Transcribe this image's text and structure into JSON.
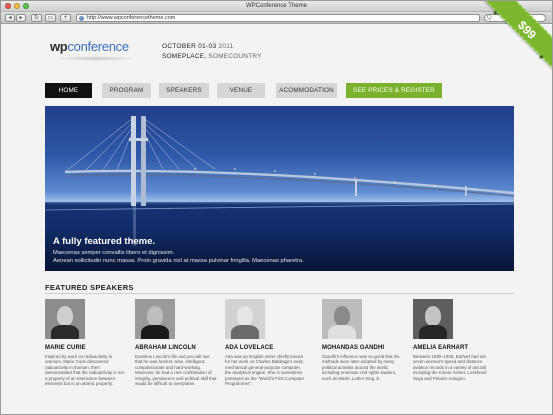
{
  "browser": {
    "window_title": "WPConference Theme",
    "url": "http://www.wpconferencetheme.com",
    "back_glyph": "◂",
    "forward_glyph": "▸",
    "reload_glyph": "↻",
    "bookmark_glyph": "▭",
    "add_glyph": "+",
    "search_glyph": "Q"
  },
  "site": {
    "logo_wp": "wp",
    "logo_conference": "conference",
    "date_main": "OCTOBER 01-03",
    "date_year": "2011",
    "place_main": "SOMEPLACE,",
    "place_country": "SOMECOUNTRY"
  },
  "nav": {
    "items": [
      {
        "label": "HOME",
        "active": true
      },
      {
        "label": "PROGRAM"
      },
      {
        "label": "SPEAKERS"
      },
      {
        "label": "VENUE"
      },
      {
        "label": "ACOMMODATION"
      }
    ],
    "cta": "SEE PRICES & REGISTER"
  },
  "hero": {
    "title": "A fully featured theme.",
    "line1": "Maecenas semper convallis libero et dignissim.",
    "line2": "Aenean sollicitudin nunc massa. Proin gravida nisl at massa pulvinar fringilla. Maecenas pharetra."
  },
  "speakers": {
    "title": "FEATURED SPEAKERS",
    "items": [
      {
        "name": "MARIE CURIE",
        "bio": "Inspired by work on radioactivity in uranium, Marie Curie discovered radioactivity in thorium, then demonstrated that the radioactivity is not a property of an interaction between elements but is an atomic property."
      },
      {
        "name": "ABRAHAM LINCOLN",
        "bio": "Examine Lincoln's life and you will see that he was honest, wise, intelligent, compassionate and hard-working. Moreover, he had a rare combination of integrity, persistence and political skill that would be difficult to overpraise."
      },
      {
        "name": "ADA LOVELACE",
        "bio": "Ada was an English writer chiefly known for her work on Charles Babbage's early mechanical general-purpose computer, the analytical engine. She is sometimes portrayed as the \"World's First Computer Programmer\"."
      },
      {
        "name": "MOHANDAS GANDHI",
        "bio": "Gandhi's influence was so great that his methods were later adopted by many political activists around the world, including American civil rights leaders, such as Martin Luther King Jr."
      },
      {
        "name": "AMELIA EARHART",
        "bio": "Between 1930–1935, Earhart had set seven women's speed and distance aviation records in a variety of aircraft including the Kinner Airster, Lockheed Vega and Pitcairn Autogiro."
      }
    ]
  },
  "ribbon": {
    "price": "$99",
    "star_glyph": "★"
  },
  "colors": {
    "accent_blue": "#3b6fc0",
    "cta_green": "#7ab12d",
    "nav_active": "#111111"
  }
}
